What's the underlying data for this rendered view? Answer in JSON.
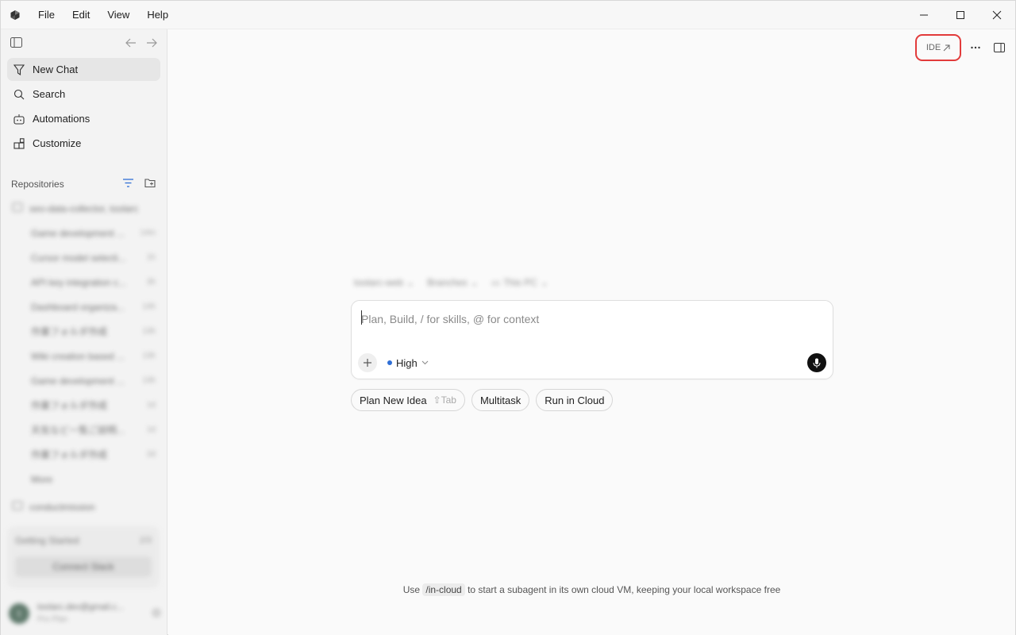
{
  "menu": [
    "File",
    "Edit",
    "View",
    "Help"
  ],
  "sidebar": {
    "nav": [
      {
        "label": "New Chat",
        "icon": "new-chat-icon"
      },
      {
        "label": "Search",
        "icon": "search-icon"
      },
      {
        "label": "Automations",
        "icon": "automations-icon"
      },
      {
        "label": "Customize",
        "icon": "customize-icon"
      }
    ],
    "repositories_label": "Repositories",
    "repo": {
      "name": "seo-data-collector, toolarc"
    },
    "chats": [
      {
        "title": "Game development ...",
        "meta": "14m"
      },
      {
        "title": "Cursor model selecti...",
        "meta": "1h"
      },
      {
        "title": "API key integration c...",
        "meta": "3h"
      },
      {
        "title": "Dashboard organiza...",
        "meta": "14h"
      },
      {
        "title": "作業フォルダ作成",
        "meta": "13h"
      },
      {
        "title": "Wiki creation based ...",
        "meta": "13h"
      },
      {
        "title": "Game development ...",
        "meta": "13h"
      },
      {
        "title": "作業フォルダ作成",
        "meta": "1d"
      },
      {
        "title": "天気など一覧ご説明...",
        "meta": "1d"
      },
      {
        "title": "作業フォルダ作成",
        "meta": "2d"
      }
    ],
    "more": "More",
    "other_repo": "conductmission",
    "getting_started": {
      "title": "Getting Started",
      "count": "2/3",
      "button": "Connect Slack"
    },
    "account": {
      "initial": "t",
      "email": "toolarc.dev@gmail.c...",
      "plan": "Pro Plan"
    }
  },
  "main": {
    "ide_label": "IDE",
    "context": {
      "repo": "toolarc-web",
      "branch": "Branches",
      "env": "This PC"
    },
    "composer": {
      "placeholder": "Plan, Build, / for skills, @ for context",
      "effort": "High"
    },
    "chips": [
      {
        "label": "Plan New Idea",
        "hint": "⇧Tab"
      },
      {
        "label": "Multitask",
        "hint": ""
      },
      {
        "label": "Run in Cloud",
        "hint": ""
      }
    ],
    "hint": {
      "prefix": "Use",
      "code": "/in-cloud",
      "suffix": "to start a subagent in its own cloud VM, keeping your local workspace free"
    }
  },
  "colors": {
    "accent_dot": "#2f6fd6",
    "highlight_ring": "#e23b3b",
    "avatar": "#2f5240"
  }
}
